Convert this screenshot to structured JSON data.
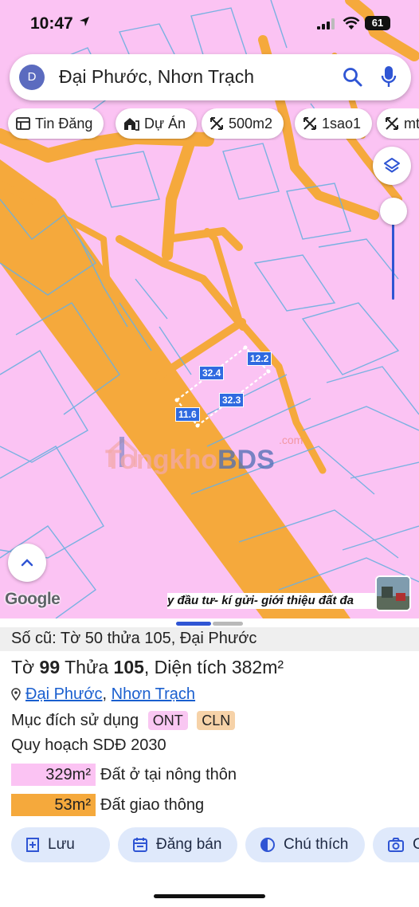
{
  "status_bar": {
    "time": "10:47",
    "battery": "61"
  },
  "search": {
    "avatar_letter": "D",
    "query": "Đại Phước, Nhơn Trạch"
  },
  "chips": [
    {
      "label": "Tin Đăng",
      "icon": "newspaper-icon"
    },
    {
      "label": "Dự Án",
      "icon": "buildings-icon"
    },
    {
      "label": "500m2",
      "icon": "area-icon"
    },
    {
      "label": "1sao1",
      "icon": "area-icon"
    },
    {
      "label": "mt",
      "icon": "area-icon"
    }
  ],
  "map": {
    "dimensions": [
      "32.4",
      "12.2",
      "32.3",
      "11.6"
    ],
    "watermark": {
      "left": "Tongkho",
      "right": "BDS",
      "suffix": ".com"
    },
    "google_logo": "Google",
    "caption": "y đầu tư- kí gửi- giới thiệu đất đa"
  },
  "sheet": {
    "old_parcel": "Số cũ: Tờ 50 thửa 105, Đại Phước",
    "parcel": {
      "sheet_label": "Tờ ",
      "sheet_no": "99",
      "lot_label": " Thửa ",
      "lot_no": "105",
      "area_text": ", Diện tích 382m²"
    },
    "address": {
      "ward": "Đại Phước",
      "separator": ", ",
      "district": "Nhơn Trạch"
    },
    "purpose_label": "Mục đích sử dụng",
    "purpose_tags": [
      "ONT",
      "CLN"
    ],
    "plan_label": "Quy hoạch SDĐ 2030",
    "land_uses": [
      {
        "area": "329m²",
        "label": "Đất ở tại nông thôn",
        "color": "#fbc3f3"
      },
      {
        "area": "53m²",
        "label": "Đất giao thông",
        "color": "#f5a93c"
      }
    ],
    "actions": [
      {
        "label": "Lưu",
        "icon": "add-bookmark-icon"
      },
      {
        "label": "Đăng bán",
        "icon": "calendar-icon"
      },
      {
        "label": "Chú thích",
        "icon": "contrast-icon"
      },
      {
        "label": "C",
        "icon": "camera-icon"
      }
    ]
  },
  "colors": {
    "residential": "#fbc3f3",
    "road": "#f5a93c",
    "parcel_line": "#6cb0e0",
    "accent": "#2f55d4"
  }
}
